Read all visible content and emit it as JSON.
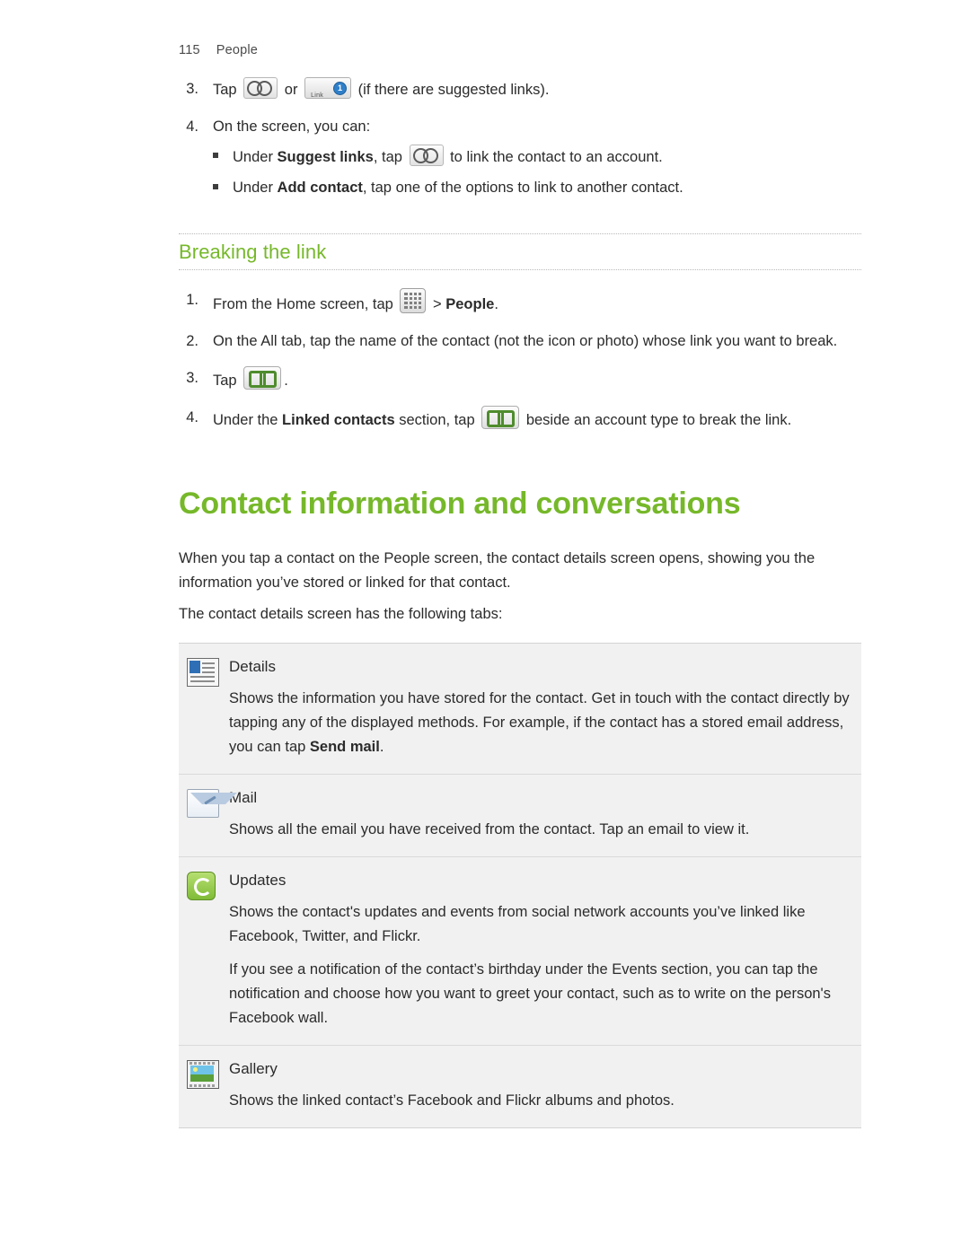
{
  "header": {
    "page_number": "115",
    "section": "People"
  },
  "steps_top": [
    {
      "num": "3.",
      "pre": "Tap",
      "mid": "or",
      "post": "(if there are suggested links)."
    },
    {
      "num": "4.",
      "text": "On the screen, you can:"
    }
  ],
  "bullets_top": [
    {
      "pre": "Under ",
      "bold": "Suggest links",
      "mid": ", tap ",
      "post": " to link the contact to an account."
    },
    {
      "pre": "Under ",
      "bold": "Add contact",
      "mid": ", tap one of the options to link to another contact.",
      "post": ""
    }
  ],
  "section_heading": "Breaking the link",
  "steps_breaking": [
    {
      "num": "1.",
      "pre": "From the Home screen, tap ",
      "mid": " > ",
      "bold": "People",
      "post": "."
    },
    {
      "num": "2.",
      "text": "On the All tab, tap the name of the contact (not the icon or photo) whose link you want to break."
    },
    {
      "num": "3.",
      "pre": "Tap ",
      "post": "."
    },
    {
      "num": "4.",
      "pre": "Under the ",
      "bold": "Linked contacts",
      "mid": " section, tap ",
      "post": " beside an account type to break the link."
    }
  ],
  "big_heading": "Contact information and conversations",
  "intro_paragraphs": [
    "When you tap a contact on the People screen, the contact details screen opens, showing you the information you’ve stored or linked for that contact.",
    "The contact details screen has the following tabs:"
  ],
  "tabs_table": [
    {
      "icon": "details-tab-icon",
      "title": "Details",
      "paragraphs": [
        "Shows the information you have stored for the contact. Get in touch with the contact directly by tapping any of the displayed methods. For example, if the contact has a stored email address, you can tap Send mail."
      ],
      "bold_in_last": "Send mail"
    },
    {
      "icon": "mail-tab-icon",
      "title": "Mail",
      "paragraphs": [
        "Shows all the email you have received from the contact. Tap an email to view it."
      ]
    },
    {
      "icon": "updates-tab-icon",
      "title": "Updates",
      "paragraphs": [
        "Shows the contact's updates and events from social network accounts you’ve linked like Facebook, Twitter, and Flickr.",
        "If you see a notification of the contact’s birthday under the Events section, you can tap the notification and choose how you want to greet your contact, such as to write on the person's Facebook wall."
      ]
    },
    {
      "icon": "gallery-tab-icon",
      "title": "Gallery",
      "paragraphs": [
        "Shows the linked contact’s Facebook and Flickr albums and photos."
      ]
    }
  ],
  "icons": {
    "link_icon": "link-contact-icon",
    "suggest_icon": "suggested-links-icon",
    "suggest_label": "Link",
    "suggest_badge": "1",
    "all_apps_icon": "all-apps-icon",
    "break_link_icon": "break-link-icon"
  },
  "colors": {
    "heading_green": "#76b82a",
    "body_text": "#2b2b2b",
    "table_bg": "#f1f1f1"
  }
}
